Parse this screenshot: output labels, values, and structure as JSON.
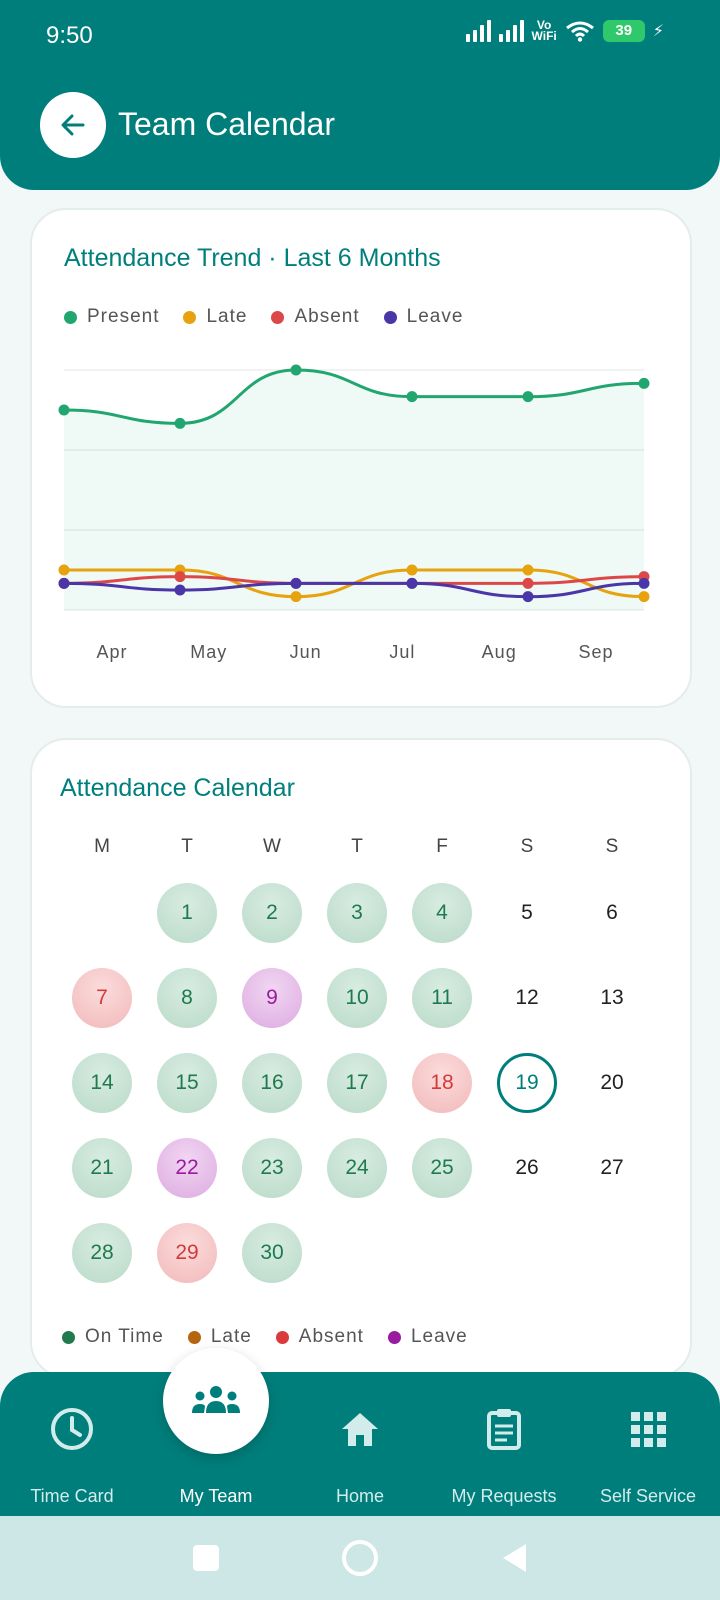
{
  "status_bar": {
    "time": "9:50",
    "vowifi_top": "Vo",
    "vowifi_bottom": "WiFi",
    "battery": "39"
  },
  "header": {
    "title": "Team Calendar"
  },
  "trend_card": {
    "title": "Attendance Trend · Last 6 Months",
    "legend": [
      {
        "label": "Present",
        "color": "#22a66f"
      },
      {
        "label": "Late",
        "color": "#e6a30e"
      },
      {
        "label": "Absent",
        "color": "#dc4848"
      },
      {
        "label": "Leave",
        "color": "#4a36a6"
      }
    ]
  },
  "chart_data": {
    "type": "line",
    "categories": [
      "Apr",
      "May",
      "Jun",
      "Jul",
      "Aug",
      "Sep"
    ],
    "grid": true,
    "series": [
      {
        "name": "Present",
        "color": "#22a66f",
        "area": true,
        "values": [
          15,
          14,
          18,
          16,
          16,
          17
        ]
      },
      {
        "name": "Late",
        "color": "#e6a30e",
        "values": [
          3,
          3,
          1,
          3,
          3,
          1
        ]
      },
      {
        "name": "Absent",
        "color": "#dc4848",
        "values": [
          2,
          2.5,
          2,
          2,
          2,
          2.5
        ]
      },
      {
        "name": "Leave",
        "color": "#4a36a6",
        "values": [
          2,
          1.5,
          2,
          2,
          1,
          2
        ]
      }
    ],
    "ylim": [
      0,
      18
    ]
  },
  "calendar_card": {
    "title": "Attendance Calendar",
    "weekdays": [
      "M",
      "T",
      "W",
      "T",
      "F",
      "S",
      "S"
    ],
    "first_weekday_index": 1,
    "days": [
      {
        "n": "1",
        "status": "ontime"
      },
      {
        "n": "2",
        "status": "ontime"
      },
      {
        "n": "3",
        "status": "ontime"
      },
      {
        "n": "4",
        "status": "ontime"
      },
      {
        "n": "5",
        "status": "none"
      },
      {
        "n": "6",
        "status": "none"
      },
      {
        "n": "7",
        "status": "absent"
      },
      {
        "n": "8",
        "status": "ontime"
      },
      {
        "n": "9",
        "status": "leave"
      },
      {
        "n": "10",
        "status": "ontime"
      },
      {
        "n": "11",
        "status": "ontime"
      },
      {
        "n": "12",
        "status": "none"
      },
      {
        "n": "13",
        "status": "none"
      },
      {
        "n": "14",
        "status": "ontime"
      },
      {
        "n": "15",
        "status": "ontime"
      },
      {
        "n": "16",
        "status": "ontime"
      },
      {
        "n": "17",
        "status": "ontime"
      },
      {
        "n": "18",
        "status": "absent"
      },
      {
        "n": "19",
        "status": "today"
      },
      {
        "n": "20",
        "status": "none"
      },
      {
        "n": "21",
        "status": "ontime"
      },
      {
        "n": "22",
        "status": "leave"
      },
      {
        "n": "23",
        "status": "ontime"
      },
      {
        "n": "24",
        "status": "ontime"
      },
      {
        "n": "25",
        "status": "ontime"
      },
      {
        "n": "26",
        "status": "none"
      },
      {
        "n": "27",
        "status": "none"
      },
      {
        "n": "28",
        "status": "ontime"
      },
      {
        "n": "29",
        "status": "absent"
      },
      {
        "n": "30",
        "status": "ontime"
      }
    ],
    "legend": [
      {
        "label": "On Time",
        "color": "#1f7a4d"
      },
      {
        "label": "Late",
        "color": "#b5650f"
      },
      {
        "label": "Absent",
        "color": "#dc3a3a"
      },
      {
        "label": "Leave",
        "color": "#9a1aa0"
      }
    ]
  },
  "bottom_nav": {
    "items": [
      {
        "label": "Time Card",
        "icon": "clock-icon"
      },
      {
        "label": "My Team",
        "icon": "team-icon",
        "active": true
      },
      {
        "label": "Home",
        "icon": "home-icon"
      },
      {
        "label": "My Requests",
        "icon": "clipboard-icon"
      },
      {
        "label": "Self Service",
        "icon": "grid-icon"
      }
    ]
  },
  "colors": {
    "primary": "#007e7b",
    "background": "#f2f8f8"
  }
}
